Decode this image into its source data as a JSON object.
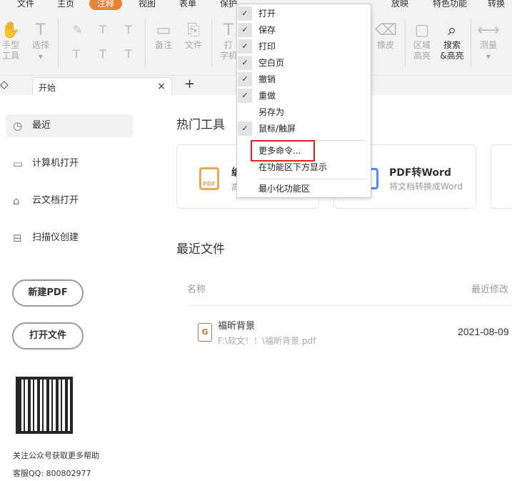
{
  "ribbon": {
    "tabs": [
      "文件",
      "主页",
      "注释",
      "视图",
      "表单",
      "保护",
      "放映",
      "特色功能",
      "转换"
    ],
    "active_tab": "注释",
    "accent": "#e8832f",
    "tools": {
      "hand": "手型\n工具",
      "select": "选择",
      "note": "备注",
      "file": "文件",
      "typewriter": "打\n字机",
      "eraser": "橡皮",
      "area_highlight": "区域\n高亮",
      "search_highlight": "搜索\n&高亮",
      "measure": "测量"
    }
  },
  "tabbar": {
    "doc_tab": "开始",
    "close": "×",
    "add": "+"
  },
  "sidebar": {
    "items": [
      {
        "label": "最近",
        "icon": "clock-icon"
      },
      {
        "label": "计算机打开",
        "icon": "monitor-icon"
      },
      {
        "label": "云文档打开",
        "icon": "cloud-icon"
      },
      {
        "label": "扫描仪创建",
        "icon": "scanner-icon"
      }
    ],
    "new_pdf": "新建PDF",
    "open_file": "打开文件",
    "qr_caption": "关注公众号获取更多帮助",
    "support": "客服QQ: 800802977"
  },
  "main": {
    "hot_tools_title": "热门工具",
    "cards": [
      {
        "title": "编",
        "subtitle": "高"
      },
      {
        "title": "PDF转Word",
        "subtitle": "将文档转换成Word"
      }
    ],
    "recent_title": "最近文件",
    "col_name": "名称",
    "col_modified": "最近修改",
    "files": [
      {
        "name": "福昕背景",
        "path": "F:\\软文！！\\福昕背景.pdf",
        "date": "2021-08-09"
      }
    ]
  },
  "menu": {
    "items": [
      {
        "label": "打开",
        "checked": true
      },
      {
        "label": "保存",
        "checked": true
      },
      {
        "label": "打印",
        "checked": true
      },
      {
        "label": "空白页",
        "checked": true
      },
      {
        "label": "撤销",
        "checked": true
      },
      {
        "label": "重做",
        "checked": true
      },
      {
        "label": "另存为",
        "checked": false
      },
      {
        "label": "鼠标/触屏",
        "checked": true
      }
    ],
    "more": "更多命令...",
    "below": "在功能区下方显示",
    "minimize": "最小化功能区",
    "check": "✓"
  },
  "highlight_color": "#e02020"
}
